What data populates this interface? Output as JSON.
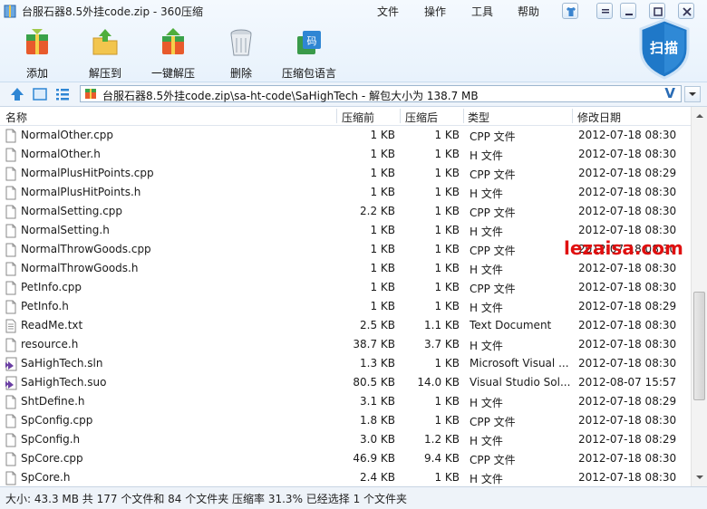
{
  "window": {
    "title": "台服石器8.5外挂code.zip - 360压缩",
    "menu": [
      "文件",
      "操作",
      "工具",
      "帮助"
    ]
  },
  "toolbar": [
    {
      "label": "添加",
      "icon": "add-archive-icon"
    },
    {
      "label": "解压到",
      "icon": "extract-to-icon"
    },
    {
      "label": "一键解压",
      "icon": "one-click-extract-icon"
    },
    {
      "label": "删除",
      "icon": "delete-trash-icon"
    },
    {
      "label": "压缩包语言",
      "icon": "archive-language-icon"
    }
  ],
  "scan_button": {
    "label": "扫描"
  },
  "address": {
    "path": "台服石器8.5外挂code.zip\\sa-ht-code\\SaHighTech - 解包大小为 138.7 MB",
    "v": "V"
  },
  "columns": {
    "name": "名称",
    "before": "压缩前",
    "after": "压缩后",
    "type": "类型",
    "date": "修改日期"
  },
  "files": [
    {
      "name": "NormalOther.cpp",
      "before": "1 KB",
      "after": "1 KB",
      "type": "CPP 文件",
      "date": "2012-07-18 08:30",
      "icon": "file-icon"
    },
    {
      "name": "NormalOther.h",
      "before": "1 KB",
      "after": "1 KB",
      "type": "H 文件",
      "date": "2012-07-18 08:30",
      "icon": "file-icon"
    },
    {
      "name": "NormalPlusHitPoints.cpp",
      "before": "1 KB",
      "after": "1 KB",
      "type": "CPP 文件",
      "date": "2012-07-18 08:29",
      "icon": "file-icon"
    },
    {
      "name": "NormalPlusHitPoints.h",
      "before": "1 KB",
      "after": "1 KB",
      "type": "H 文件",
      "date": "2012-07-18 08:30",
      "icon": "file-icon"
    },
    {
      "name": "NormalSetting.cpp",
      "before": "2.2 KB",
      "after": "1 KB",
      "type": "CPP 文件",
      "date": "2012-07-18 08:30",
      "icon": "file-icon"
    },
    {
      "name": "NormalSetting.h",
      "before": "1 KB",
      "after": "1 KB",
      "type": "H 文件",
      "date": "2012-07-18 08:30",
      "icon": "file-icon"
    },
    {
      "name": "NormalThrowGoods.cpp",
      "before": "1 KB",
      "after": "1 KB",
      "type": "CPP 文件",
      "date": "2012-07-18 08:30",
      "icon": "file-icon"
    },
    {
      "name": "NormalThrowGoods.h",
      "before": "1 KB",
      "after": "1 KB",
      "type": "H 文件",
      "date": "2012-07-18 08:30",
      "icon": "file-icon"
    },
    {
      "name": "PetInfo.cpp",
      "before": "1 KB",
      "after": "1 KB",
      "type": "CPP 文件",
      "date": "2012-07-18 08:30",
      "icon": "file-icon"
    },
    {
      "name": "PetInfo.h",
      "before": "1 KB",
      "after": "1 KB",
      "type": "H 文件",
      "date": "2012-07-18 08:29",
      "icon": "file-icon"
    },
    {
      "name": "ReadMe.txt",
      "before": "2.5 KB",
      "after": "1.1 KB",
      "type": "Text Document",
      "date": "2012-07-18 08:30",
      "icon": "text-file-icon"
    },
    {
      "name": "resource.h",
      "before": "38.7 KB",
      "after": "3.7 KB",
      "type": "H 文件",
      "date": "2012-07-18 08:30",
      "icon": "file-icon"
    },
    {
      "name": "SaHighTech.sln",
      "before": "1.3 KB",
      "after": "1 KB",
      "type": "Microsoft Visual ...",
      "date": "2012-07-18 08:30",
      "icon": "visual-studio-icon"
    },
    {
      "name": "SaHighTech.suo",
      "before": "80.5 KB",
      "after": "14.0 KB",
      "type": "Visual Studio Sol...",
      "date": "2012-08-07 15:57",
      "icon": "visual-studio-icon"
    },
    {
      "name": "ShtDefine.h",
      "before": "3.1 KB",
      "after": "1 KB",
      "type": "H 文件",
      "date": "2012-07-18 08:29",
      "icon": "file-icon"
    },
    {
      "name": "SpConfig.cpp",
      "before": "1.8 KB",
      "after": "1 KB",
      "type": "CPP 文件",
      "date": "2012-07-18 08:30",
      "icon": "file-icon"
    },
    {
      "name": "SpConfig.h",
      "before": "3.0 KB",
      "after": "1.2 KB",
      "type": "H 文件",
      "date": "2012-07-18 08:29",
      "icon": "file-icon"
    },
    {
      "name": "SpCore.cpp",
      "before": "46.9 KB",
      "after": "9.4 KB",
      "type": "CPP 文件",
      "date": "2012-07-18 08:30",
      "icon": "file-icon"
    },
    {
      "name": "SpCore.h",
      "before": "2.4 KB",
      "after": "1 KB",
      "type": "H 文件",
      "date": "2012-07-18 08:30",
      "icon": "file-icon"
    }
  ],
  "status": "大小: 43.3 MB 共 177 个文件和 84 个文件夹 压缩率 31.3% 已经选择 1 个文件夹",
  "watermark": "lezaisa.com",
  "colors": {
    "accent": "#2a6cb5",
    "watermark": "#e01010",
    "scan_shield": "#1f78c8"
  }
}
